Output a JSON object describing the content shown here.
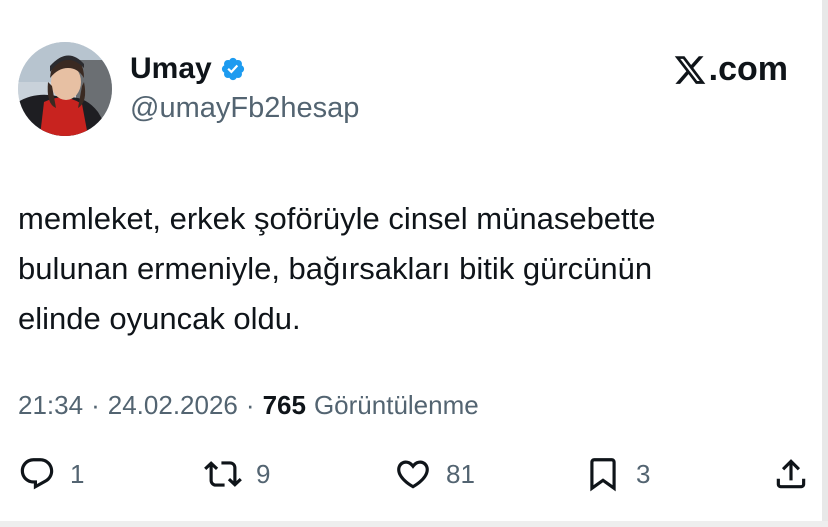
{
  "author": {
    "name": "Umay",
    "handle": "@umayFb2hesap"
  },
  "brand": {
    "label": ".com"
  },
  "tweet": {
    "text": "memleket, erkek şoförüyle cinsel münasebette\nbulunan ermeniyle, bağırsakları bitik gürcünün\nelinde oyuncak oldu."
  },
  "meta": {
    "time": "21:34",
    "separator": "·",
    "date": "24.02.2026",
    "views_count": "765",
    "views_label": "Görüntülenme"
  },
  "actions": {
    "replies": "1",
    "retweets": "9",
    "likes": "81",
    "bookmarks": "3"
  },
  "icons": {
    "verified": "verified-badge-icon",
    "logo": "x-logo-icon",
    "reply": "reply-icon",
    "retweet": "retweet-icon",
    "like": "heart-icon",
    "bookmark": "bookmark-icon",
    "share": "share-icon"
  },
  "colors": {
    "verified": "#1d9bf0",
    "text": "#0f1419",
    "secondary": "#536471"
  }
}
